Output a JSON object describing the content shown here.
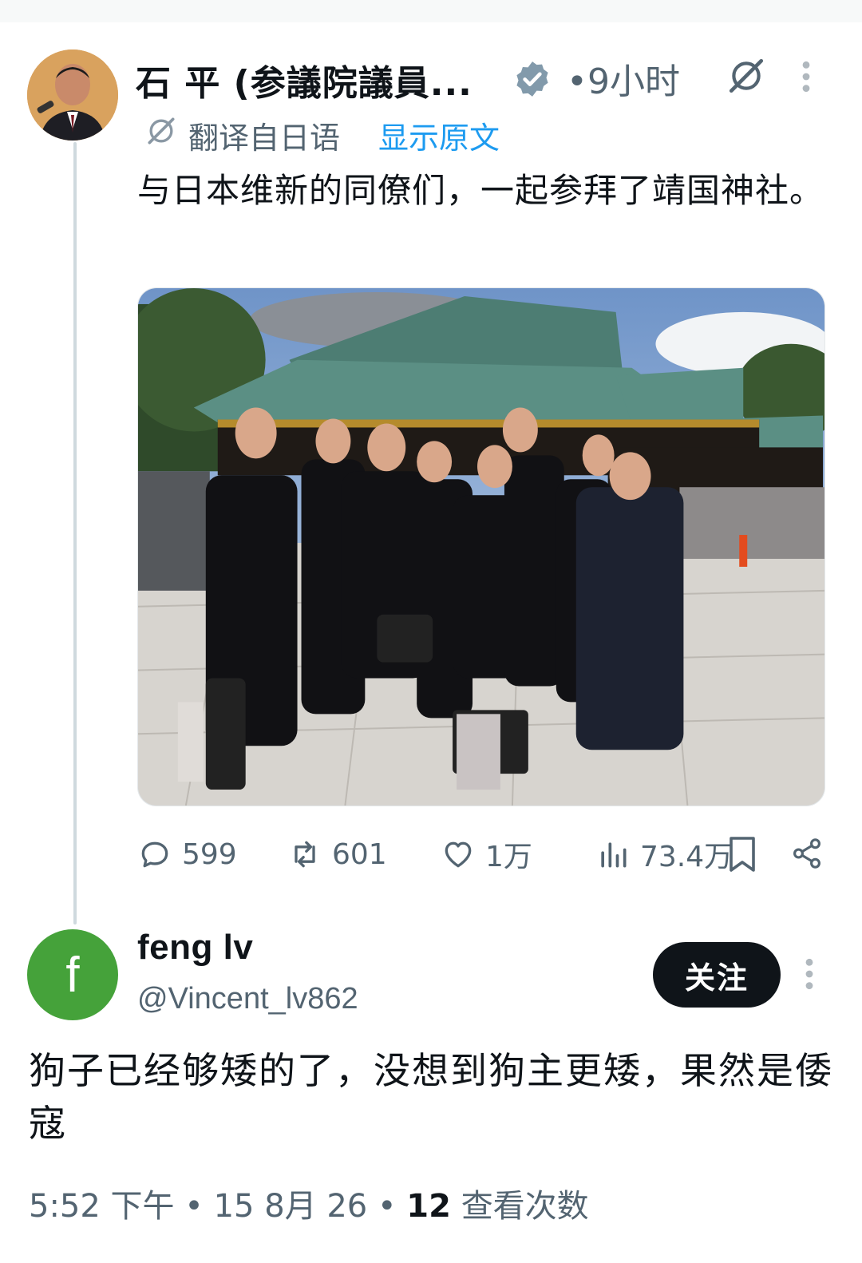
{
  "colors": {
    "accent": "#1d9bf0",
    "secondary_text": "#536471",
    "primary_text": "#0f1419",
    "thread_line": "#cfd9de",
    "reply_avatar_bg": "#45a23a"
  },
  "parent_tweet": {
    "author_name": "石 平 (参議院議員...",
    "verified_icon": "verified-badge-icon",
    "time": "9小时",
    "time_prefix": "•",
    "grok_icon": "grok-icon",
    "more_icon": "more-vertical-icon",
    "translation": {
      "icon": "translate-icon",
      "label": "翻译自日语",
      "show_original": "显示原文"
    },
    "text": "与日本维新的同僚们，一起参拜了靖国神社。",
    "photo_icon": "photo",
    "actions": {
      "replies": "599",
      "retweets": "601",
      "likes": "1万",
      "views": "73.4万"
    }
  },
  "reply_tweet": {
    "avatar_letter": "f",
    "author_name": "feng lv",
    "handle": "@Vincent_lv862",
    "follow_label": "关注",
    "text": "狗子已经够矮的了，没想到狗主更矮，果然是倭寇",
    "meta": {
      "time": "5:52 下午",
      "date": "15 8月 26",
      "separator": "•",
      "views_count": "12",
      "views_label": "查看次数"
    }
  }
}
